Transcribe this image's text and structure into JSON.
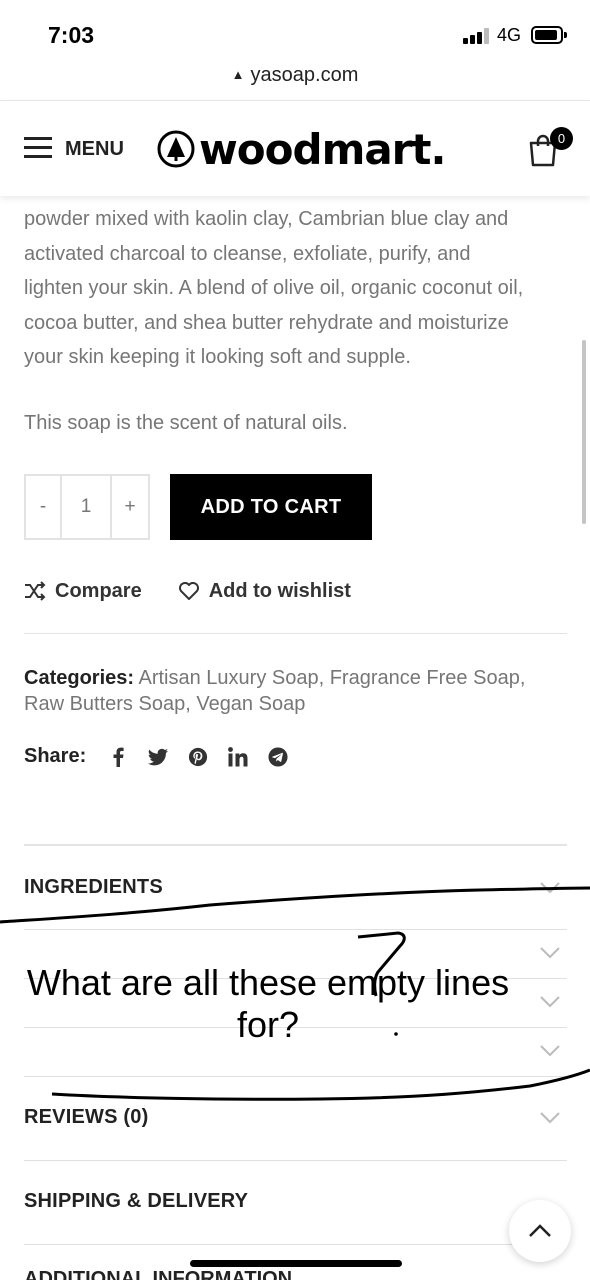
{
  "status": {
    "time": "7:03",
    "network": "4G"
  },
  "browser": {
    "url": "yasoap.com"
  },
  "header": {
    "menu_label": "MENU",
    "logo_text": "woodmart.",
    "cart_count": "0"
  },
  "product": {
    "description_lines": [
      "powder mixed with kaolin clay, Cambrian blue clay and",
      "activated charcoal to cleanse, exfoliate, purify, and",
      "lighten your skin. A blend of olive oil, organic coconut oil,",
      "cocoa butter, and shea butter rehydrate and moisturize",
      "your skin keeping it looking soft and supple."
    ],
    "scent": "This soap is the scent of natural oils.",
    "quantity": {
      "minus": "-",
      "value": "1",
      "plus": "+"
    },
    "add_to_cart": "ADD TO CART",
    "compare": "Compare",
    "wishlist": "Add to wishlist",
    "categories_label": "Categories:",
    "categories": [
      "Artisan Luxury Soap",
      "Fragrance Free Soap",
      "Raw Butters Soap",
      "Vegan Soap"
    ],
    "share_label": "Share:"
  },
  "accordion": {
    "ingredients": "INGREDIENTS",
    "reviews": "REVIEWS (0)",
    "shipping": "SHIPPING & DELIVERY",
    "additional": "ADDITIONAL INFORMATION"
  },
  "annotation": {
    "note": "What are all these empty lines for?"
  }
}
